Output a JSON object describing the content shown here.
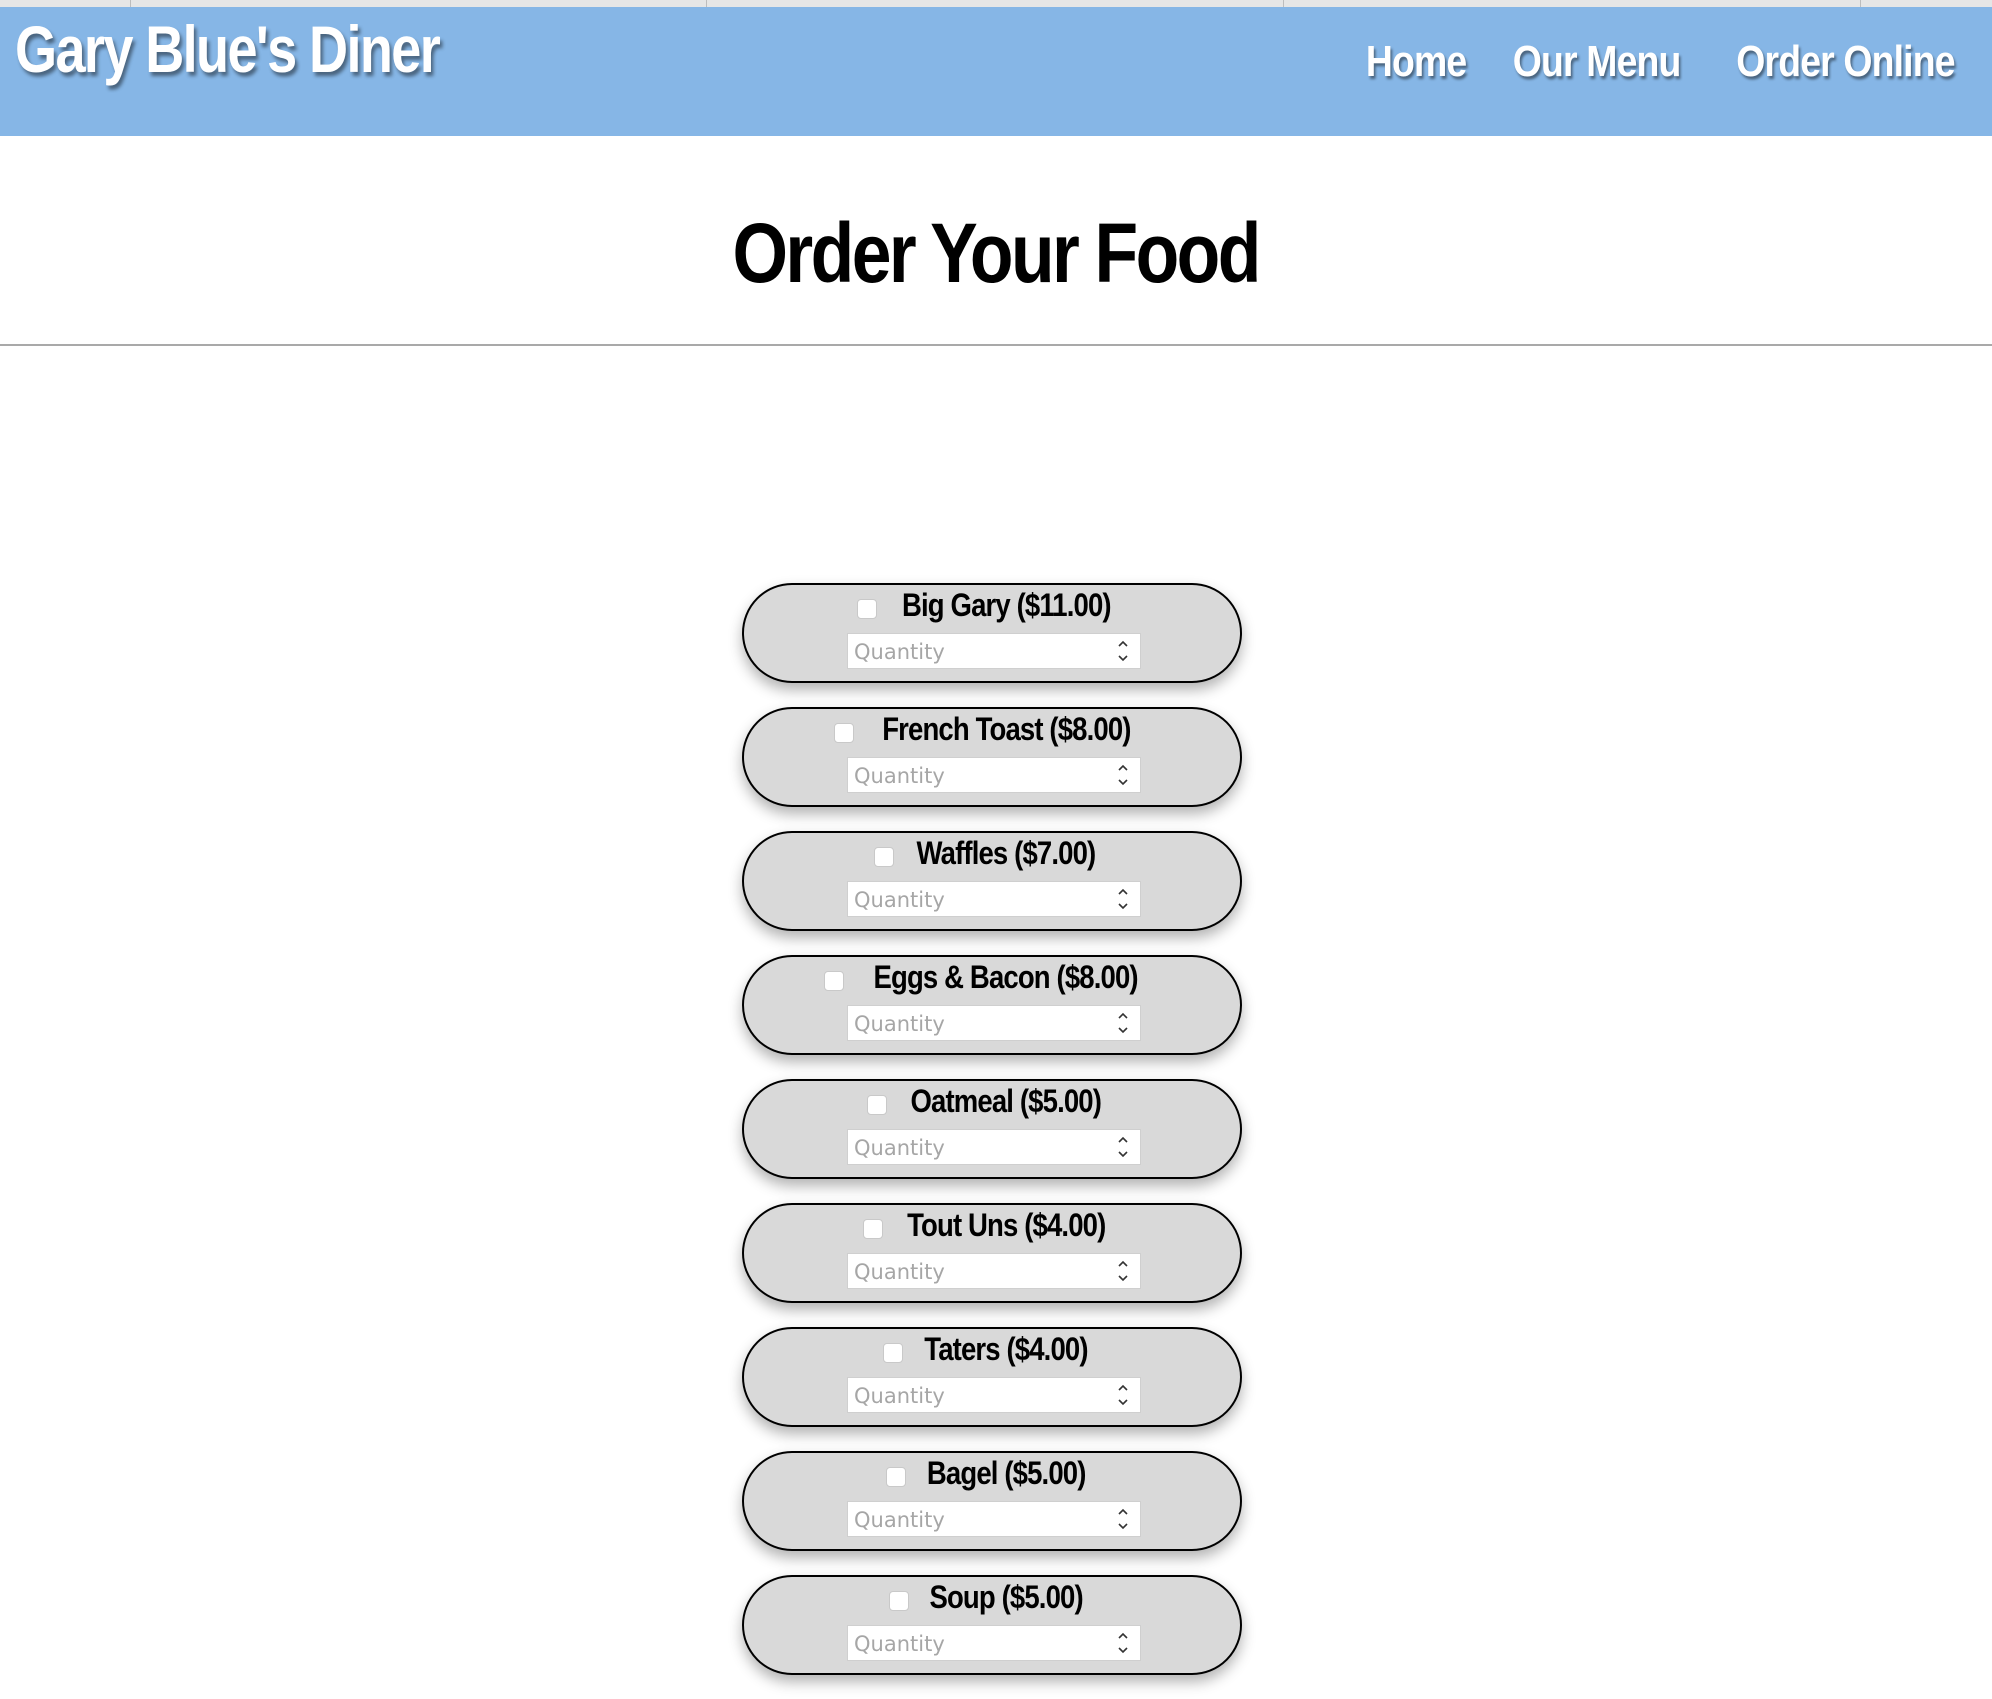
{
  "site": {
    "brand": "Gary Blue's Diner",
    "nav": [
      {
        "label": "Home"
      },
      {
        "label": "Our Menu"
      },
      {
        "label": "Order Online"
      }
    ]
  },
  "page": {
    "title": "Order Your Food"
  },
  "order_items": [
    {
      "label": "Big Gary ($11.00)",
      "checked": false,
      "quantity": "",
      "placeholder": "Quantity"
    },
    {
      "label": "French Toast ($8.00)",
      "checked": false,
      "quantity": "",
      "placeholder": "Quantity"
    },
    {
      "label": "Waffles ($7.00)",
      "checked": false,
      "quantity": "",
      "placeholder": "Quantity"
    },
    {
      "label": "Eggs & Bacon ($8.00)",
      "checked": false,
      "quantity": "",
      "placeholder": "Quantity"
    },
    {
      "label": "Oatmeal ($5.00)",
      "checked": false,
      "quantity": "",
      "placeholder": "Quantity"
    },
    {
      "label": "Tout Uns ($4.00)",
      "checked": false,
      "quantity": "",
      "placeholder": "Quantity"
    },
    {
      "label": "Taters ($4.00)",
      "checked": false,
      "quantity": "",
      "placeholder": "Quantity"
    },
    {
      "label": "Bagel ($5.00)",
      "checked": false,
      "quantity": "",
      "placeholder": "Quantity"
    },
    {
      "label": "Soup ($5.00)",
      "checked": false,
      "quantity": "",
      "placeholder": "Quantity"
    }
  ],
  "colors": {
    "header_bg": "#86b6e6",
    "item_bg": "#d9d9d9"
  },
  "icons": {
    "stepper": "up-down-chevron-icon"
  }
}
